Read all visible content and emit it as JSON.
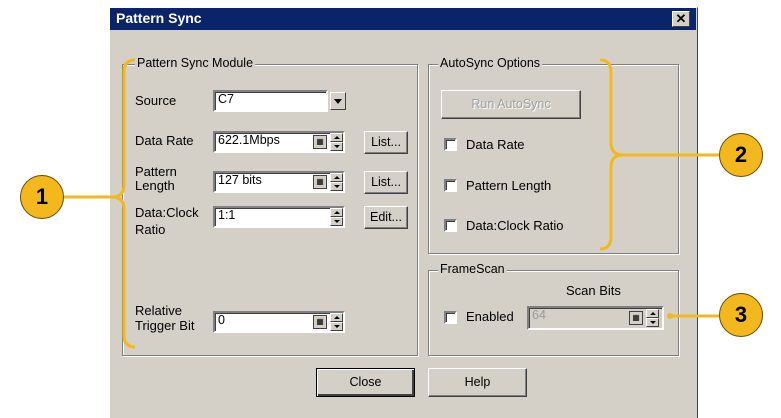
{
  "window": {
    "title": "Pattern Sync",
    "close_icon": "close-icon"
  },
  "module": {
    "legend": "Pattern Sync Module",
    "source_label": "Source",
    "source_value": "C7",
    "data_rate_label": "Data Rate",
    "data_rate_value": "622.1Mbps",
    "data_rate_button": "List...",
    "pattern_length_label_1": "Pattern",
    "pattern_length_label_2": "Length",
    "pattern_length_value": "127 bits",
    "pattern_length_button": "List...",
    "ratio_label_1": "Data:Clock",
    "ratio_label_2": "Ratio",
    "ratio_value": "1:1",
    "ratio_button": "Edit...",
    "trigger_label_1": "Relative",
    "trigger_label_2": "Trigger Bit",
    "trigger_value": "0"
  },
  "autosync": {
    "legend": "AutoSync Options",
    "run_button": "Run AutoSync",
    "options": [
      "Data Rate",
      "Pattern Length",
      "Data:Clock Ratio"
    ]
  },
  "framescan": {
    "legend": "FrameScan",
    "enabled_label": "Enabled",
    "scan_bits_label": "Scan Bits",
    "scan_bits_value": "64"
  },
  "buttons": {
    "close": "Close",
    "help": "Help"
  },
  "callouts": [
    "1",
    "2",
    "3"
  ],
  "colors": {
    "titlebar": "#0a246a",
    "callout_fill": "#f3b81e",
    "bracket": "#f3b81e"
  }
}
